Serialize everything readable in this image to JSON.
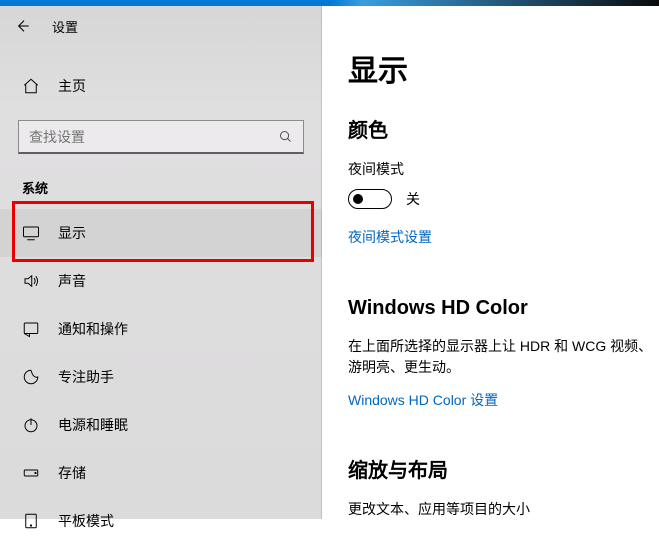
{
  "header": {
    "app_title": "设置"
  },
  "sidebar": {
    "home_label": "主页",
    "search_placeholder": "查找设置",
    "section_title": "系统",
    "items": [
      {
        "label": "显示"
      },
      {
        "label": "声音"
      },
      {
        "label": "通知和操作"
      },
      {
        "label": "专注助手"
      },
      {
        "label": "电源和睡眠"
      },
      {
        "label": "存储"
      },
      {
        "label": "平板模式"
      }
    ]
  },
  "content": {
    "page_title": "显示",
    "color": {
      "section_title": "颜色",
      "night_label": "夜间模式",
      "night_state": "关",
      "night_link": "夜间模式设置"
    },
    "hdr": {
      "section_title": "Windows HD Color",
      "desc": "在上面所选择的显示器上让 HDR 和 WCG 视频、游明亮、更生动。",
      "link": "Windows HD Color 设置"
    },
    "scale": {
      "section_title": "缩放与布局",
      "change_label": "更改文本、应用等项目的大小"
    }
  }
}
